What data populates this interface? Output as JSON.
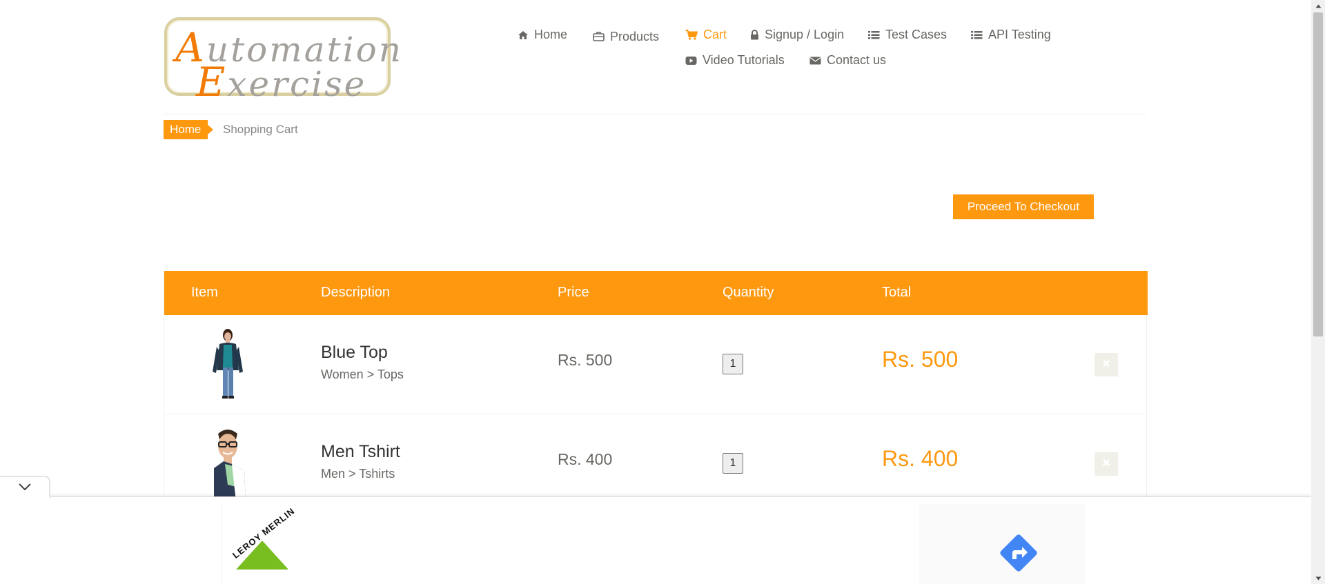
{
  "logo": {
    "line1_cap": "A",
    "line1_rest": "utomation",
    "line2_cap": "E",
    "line2_rest": "xercise"
  },
  "nav": {
    "items": [
      {
        "label": "Home",
        "icon": "home-icon",
        "active": false
      },
      {
        "label": "Products",
        "icon": "briefcase-icon",
        "active": false
      },
      {
        "label": "Cart",
        "icon": "cart-icon",
        "active": true
      },
      {
        "label": "Signup / Login",
        "icon": "lock-icon",
        "active": false
      },
      {
        "label": "Test Cases",
        "icon": "list-icon",
        "active": false
      },
      {
        "label": "API Testing",
        "icon": "list-icon",
        "active": false
      },
      {
        "label": "Video Tutorials",
        "icon": "youtube-icon",
        "active": false
      },
      {
        "label": "Contact us",
        "icon": "envelope-icon",
        "active": false
      }
    ],
    "active_color": "#fe980f"
  },
  "breadcrumb": {
    "home": "Home",
    "current": "Shopping Cart"
  },
  "checkout_button": "Proceed To Checkout",
  "cart": {
    "headers": {
      "item": "Item",
      "description": "Description",
      "price": "Price",
      "quantity": "Quantity",
      "total": "Total"
    },
    "rows": [
      {
        "name": "Blue Top",
        "category": "Women > Tops",
        "price": "Rs. 500",
        "quantity": "1",
        "total": "Rs. 500"
      },
      {
        "name": "Men Tshirt",
        "category": "Men > Tshirts",
        "price": "Rs. 400",
        "quantity": "1",
        "total": "Rs. 400"
      }
    ]
  },
  "ad": {
    "brand": "LEROY MERLIN",
    "brand_color": "#78be20",
    "nav_icon_color": "#4285f4"
  },
  "colors": {
    "accent": "#fe980f",
    "text": "#696763"
  }
}
